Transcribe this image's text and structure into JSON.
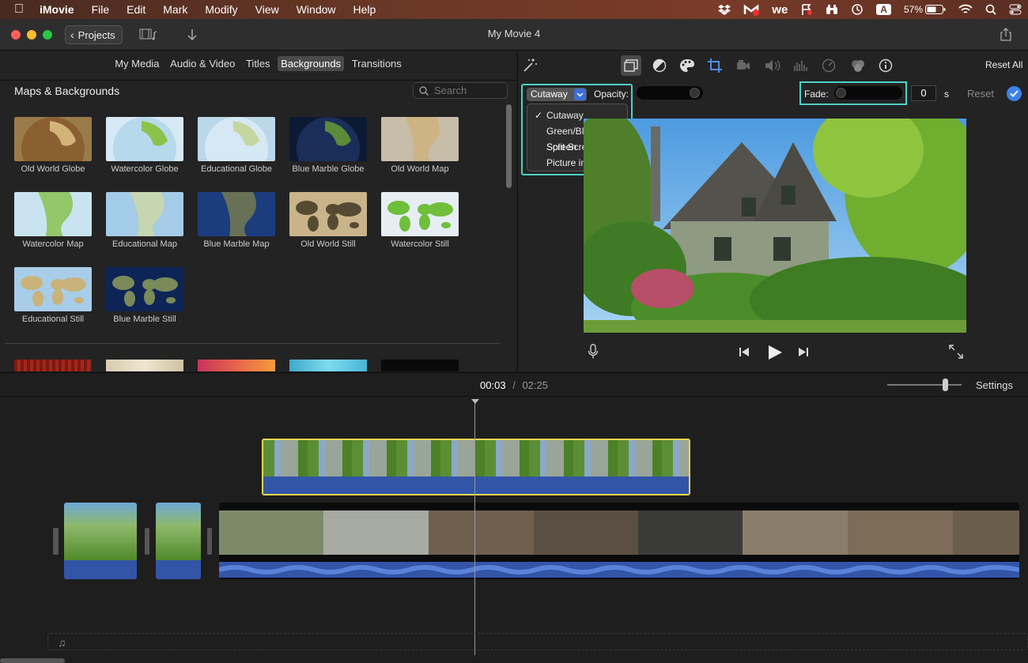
{
  "menubar": {
    "app": "iMovie",
    "items": [
      "File",
      "Edit",
      "Mark",
      "Modify",
      "View",
      "Window",
      "Help"
    ],
    "status": {
      "ime": "A",
      "battery": "57%"
    }
  },
  "titlebar": {
    "projects_label": "Projects",
    "title": "My Movie 4"
  },
  "browser": {
    "tabs": [
      {
        "label": "My Media",
        "selected": false
      },
      {
        "label": "Audio & Video",
        "selected": false
      },
      {
        "label": "Titles",
        "selected": false
      },
      {
        "label": "Backgrounds",
        "selected": true
      },
      {
        "label": "Transitions",
        "selected": false
      }
    ],
    "section_title": "Maps & Backgrounds",
    "search_placeholder": "Search",
    "items": [
      {
        "label": "Old World Globe",
        "style": "globe-old"
      },
      {
        "label": "Watercolor Globe",
        "style": "globe-watercolor"
      },
      {
        "label": "Educational Globe",
        "style": "globe-educational"
      },
      {
        "label": "Blue Marble Globe",
        "style": "globe-bluemarble"
      },
      {
        "label": "Old World Map",
        "style": "map-old"
      },
      {
        "label": "Watercolor Map",
        "style": "map-watercolor"
      },
      {
        "label": "Educational Map",
        "style": "map-educational"
      },
      {
        "label": "Blue Marble Map",
        "style": "map-bluemarble"
      },
      {
        "label": "Old World Still",
        "style": "still-old"
      },
      {
        "label": "Watercolor Still",
        "style": "still-watercolor"
      },
      {
        "label": "Educational Still",
        "style": "still-educational"
      },
      {
        "label": "Blue Marble Still",
        "style": "still-bluemarble"
      }
    ]
  },
  "viewer": {
    "reset_all": "Reset All",
    "overlay_mode": "Cutaway",
    "opacity_label": "Opacity:",
    "fade_label": "Fade:",
    "fade_value": "0",
    "fade_unit": "s",
    "reset_label": "Reset",
    "menu_options": [
      {
        "label": "Cutaway",
        "checked": true
      },
      {
        "label": "Green/Blue Screen",
        "checked": false
      },
      {
        "label": "Split Screen",
        "checked": false
      },
      {
        "label": "Picture in Picture",
        "checked": false
      }
    ],
    "opacity_level": 1.0,
    "fade_level": 0.0
  },
  "timeline": {
    "current_time": "00:03",
    "separator": "/",
    "total_time": "02:25",
    "settings_label": "Settings"
  },
  "colors": {
    "accent_highlight": "#4fd1c5",
    "selection_yellow": "#f2d650",
    "audio_blue": "#3355a8"
  }
}
